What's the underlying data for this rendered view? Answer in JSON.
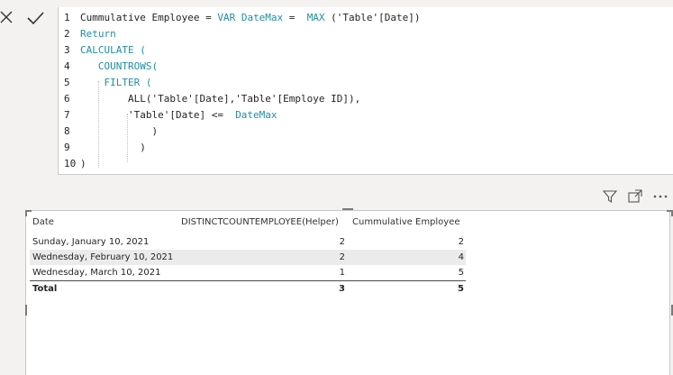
{
  "formula_bar": {
    "cancel_icon": "close-icon",
    "commit_icon": "checkmark-icon",
    "lines": [
      {
        "n": "1",
        "parts": [
          [
            "Cummulative Employee = ",
            ""
          ],
          [
            "VAR DateMax",
            "kw"
          ],
          [
            " =  ",
            ""
          ],
          [
            "MAX",
            "kw"
          ],
          [
            " ('Table'[Date])",
            ""
          ]
        ]
      },
      {
        "n": "2",
        "parts": [
          [
            "Return",
            "kw"
          ]
        ]
      },
      {
        "n": "3",
        "parts": [
          [
            "CALCULATE (",
            "kw"
          ]
        ]
      },
      {
        "n": "4",
        "parts": [
          [
            "   COUNTROWS(",
            "kw"
          ]
        ]
      },
      {
        "n": "5",
        "parts": [
          [
            "    FILTER (",
            "kw"
          ]
        ]
      },
      {
        "n": "6",
        "parts": [
          [
            "        ALL('Table'[Date],'Table'[Employe ID]),",
            ""
          ]
        ]
      },
      {
        "n": "7",
        "parts": [
          [
            "        'Table'[Date] <=  ",
            ""
          ],
          [
            "DateMax",
            "kw"
          ]
        ]
      },
      {
        "n": "8",
        "parts": [
          [
            "            )",
            ""
          ]
        ]
      },
      {
        "n": "9",
        "parts": [
          [
            "          )",
            ""
          ]
        ]
      },
      {
        "n": "10",
        "parts": [
          [
            ")",
            ""
          ]
        ]
      }
    ]
  },
  "visual_toolbar": {
    "icons": [
      "filter-icon",
      "focus-mode-icon",
      "more-options-icon"
    ]
  },
  "table": {
    "columns": [
      "Date",
      "DISTINCTCOUNTEMPLOYEE(Helper)",
      "Cummulative Employee"
    ],
    "rows": [
      [
        "Sunday, January 10, 2021",
        "2",
        "2"
      ],
      [
        "Wednesday, February 10, 2021",
        "2",
        "4"
      ],
      [
        "Wednesday, March 10, 2021",
        "1",
        "5"
      ]
    ],
    "total": [
      "Total",
      "3",
      "5"
    ]
  },
  "colors": {
    "keyword": "#1d8fa4",
    "background": "#f3f2f1",
    "row_alt": "#ebebeb"
  }
}
